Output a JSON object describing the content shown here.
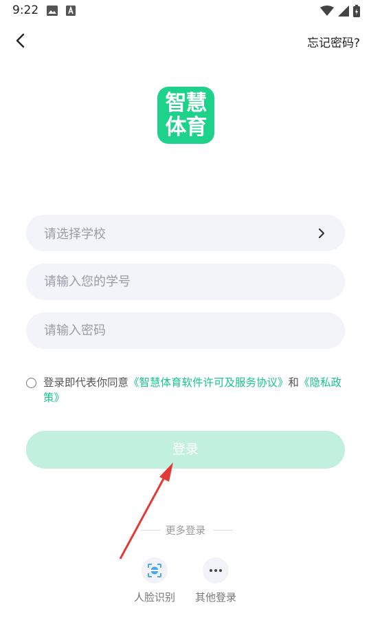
{
  "status_bar": {
    "time": "9:22",
    "icons": [
      "image-icon",
      "app-store-icon",
      "wifi-icon",
      "signal-icon",
      "battery-icon"
    ]
  },
  "header": {
    "forgot_password": "忘记密码?"
  },
  "logo": {
    "line1": "智慧",
    "line2": "体育",
    "color": "#1ED28C"
  },
  "form": {
    "school_placeholder": "请选择学校",
    "student_id_placeholder": "请输入您的学号",
    "password_placeholder": "请输入密码"
  },
  "agreement": {
    "prefix": "登录即代表你同意",
    "license_link": "《智慧体育软件许可及服务协议》",
    "and": "和",
    "privacy_link": "《隐私政策》"
  },
  "login_button": "登录",
  "more_login": {
    "title": "更多登录",
    "options": [
      {
        "label": "人脸识别",
        "icon": "face-recognition-icon"
      },
      {
        "label": "其他登录",
        "icon": "more-dots-icon"
      }
    ]
  },
  "colors": {
    "accent": "#18C68A",
    "button_disabled": "#C2F0DF",
    "field_bg": "#F3F4F9",
    "annotation_arrow": "#E53935"
  }
}
